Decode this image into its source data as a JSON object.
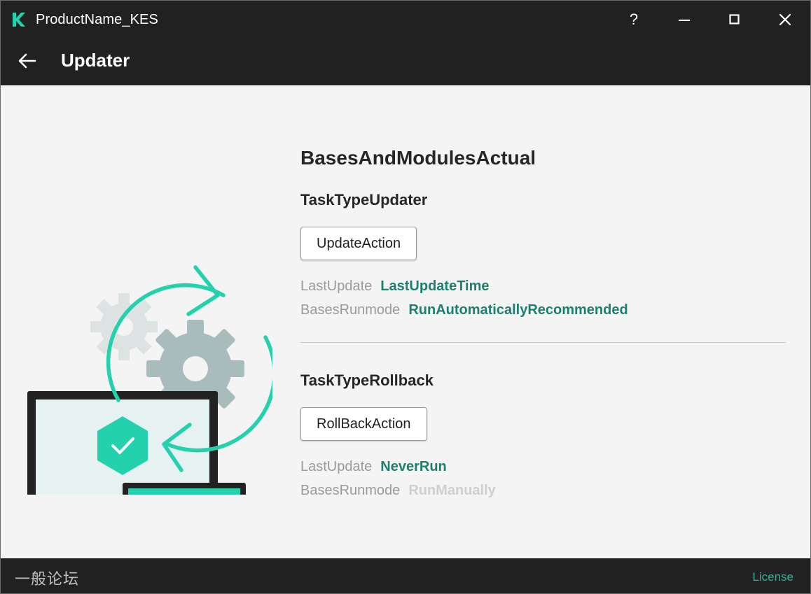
{
  "window": {
    "title": "ProductName_KES",
    "help_label": "?",
    "accent_color": "#23d1ad",
    "link_color": "#1e7f6e",
    "bar_color": "#212121"
  },
  "header": {
    "title": "Updater",
    "back_icon": "arrow-left-icon"
  },
  "main": {
    "section_title": "BasesAndModulesActual",
    "update_task": {
      "title": "TaskTypeUpdater",
      "action_label": "UpdateAction",
      "rows": [
        {
          "label": "LastUpdate",
          "value": "LastUpdateTime"
        },
        {
          "label": "BasesRunmode",
          "value": "RunAutomaticallyRecommended"
        }
      ]
    },
    "rollback_task": {
      "title": "TaskTypeRollback",
      "action_label": "RollBackAction",
      "rows": [
        {
          "label": "LastUpdate",
          "value": "NeverRun"
        },
        {
          "label": "BasesRunmode",
          "value": "RunManually"
        }
      ]
    }
  },
  "footer": {
    "watermark_text": "一般论坛",
    "license_label": "License"
  }
}
